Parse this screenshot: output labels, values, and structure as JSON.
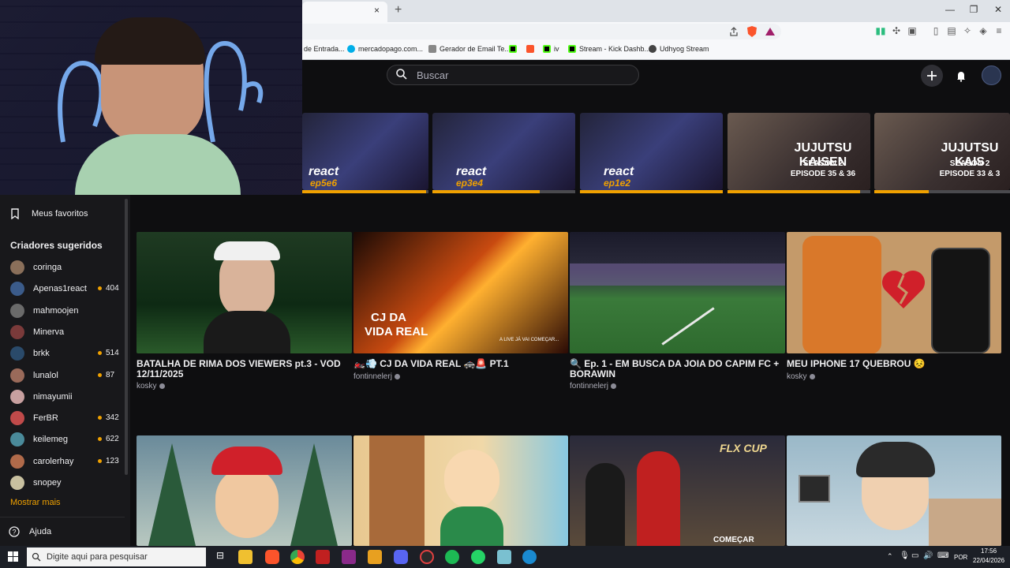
{
  "browser": {
    "tab_close": "×",
    "new_tab": "+",
    "bookmarks": [
      {
        "label": "de Entrada...",
        "color": "#d93025"
      },
      {
        "label": "mercadopago.com...",
        "color": "#00aee8"
      },
      {
        "label": "Gerador de Email Te...",
        "color": "#888888"
      },
      {
        "label": "",
        "color": "#53fc18"
      },
      {
        "label": "",
        "color": "#fb542b"
      },
      {
        "label": "iv",
        "color": "#53fc18"
      },
      {
        "label": "Stream - Kick Dashb...",
        "color": "#53fc18"
      },
      {
        "label": "Udhyog Stream",
        "color": "#444444"
      }
    ],
    "window_buttons": [
      "—",
      "❐",
      "✕"
    ]
  },
  "header": {
    "search_placeholder": "Buscar",
    "icons": [
      "search-icon",
      "plus-icon",
      "bell-icon"
    ]
  },
  "sidebar": {
    "favorites_label": "Meus favoritos",
    "suggested_title": "Criadores sugeridos",
    "creators": [
      {
        "name": "coringa",
        "count": "",
        "color": "#8a6f5a"
      },
      {
        "name": "Apenas1react",
        "count": "404",
        "color": "#3b5b8a"
      },
      {
        "name": "mahmoojen",
        "count": "",
        "color": "#6a6a6a"
      },
      {
        "name": "Minerva",
        "count": "",
        "color": "#7a3a3a"
      },
      {
        "name": "brkk",
        "count": "514",
        "color": "#2a4a6a"
      },
      {
        "name": "lunalol",
        "count": "87",
        "color": "#9a6a5a"
      },
      {
        "name": "nimayumii",
        "count": "",
        "color": "#c8a0a0"
      },
      {
        "name": "FerBR",
        "count": "342",
        "color": "#c04a4a"
      },
      {
        "name": "keilemeg",
        "count": "622",
        "color": "#4a8a9a"
      },
      {
        "name": "carolerhay",
        "count": "123",
        "color": "#b06a4a"
      },
      {
        "name": "snopey",
        "count": "",
        "color": "#c8c0a0"
      }
    ],
    "show_more": "Mostrar mais",
    "help": "Ajuda"
  },
  "top_thumbnails": [
    {
      "text": "react",
      "sub": "ep5e6",
      "progress": 0.98
    },
    {
      "text": "react",
      "sub": "ep3e4",
      "progress": 0.75
    },
    {
      "text": "react",
      "sub": "ep1e2",
      "progress": 1.0
    },
    {
      "text": "JUJUTSU KAISEN",
      "sub": "SEASON 2\nEPISODE 35 & 36",
      "progress": 0.93
    },
    {
      "text": "JUJUTSU KAIS",
      "sub": "SEASON 2\nEPISODE 33 & 3",
      "progress": 0.4
    }
  ],
  "videos": [
    {
      "title": "BATALHA DE RIMA DOS VIEWERS pt.3 - VOD 12/11/2025",
      "author": "kosky"
    },
    {
      "title": "🏍️💨 CJ DA VIDA REAL 🚓🚨 PT.1",
      "author": "fontinnelerj"
    },
    {
      "title": "🔍 Ep. 1 - EM BUSCA DA JOIA DO CAPIM FC + BORAWIN",
      "author": "fontinnelerj"
    },
    {
      "title": "MEU IPHONE 17 QUEBROU 😣",
      "author": "kosky"
    }
  ],
  "thumb_texts": {
    "cj_line1": "CJ DA",
    "cj_line2": "VIDA REAL",
    "live_caption": "A LIVE JÁ VAI COMEÇAR...",
    "flx": "FLX CUP",
    "comecar": "COMEÇAR"
  },
  "taskbar": {
    "search_placeholder": "Digite aqui para pesquisar",
    "lang": "POR",
    "time": "17:56",
    "date": "22/04/2026"
  }
}
